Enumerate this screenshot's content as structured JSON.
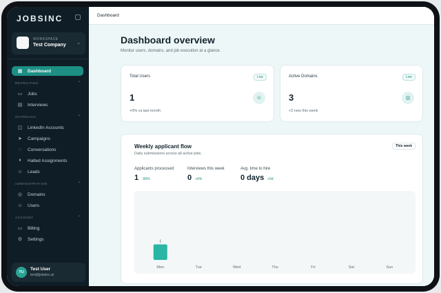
{
  "app": {
    "logo": "JOBSINC",
    "workspace_kicker": "WORKSPACE",
    "workspace_name": "Test Company"
  },
  "sidebar": {
    "dashboard": "Dashboard",
    "sections": {
      "recruiting": "RECRUITING",
      "outreach": "OUTREACH",
      "administration": "ADMINISTRATION",
      "account": "ACCOUNT"
    },
    "items": {
      "jobs": "Jobs",
      "interviews": "Interviews",
      "linkedin": "LinkedIn Accounts",
      "campaigns": "Campaigns",
      "conversations": "Conversations",
      "halted": "Halted Assignments",
      "leads": "Leads",
      "domains": "Domains",
      "users": "Users",
      "billing": "Billing",
      "settings": "Settings"
    },
    "user": {
      "initials": "TU",
      "name": "Test User",
      "email": "test@jobsinc.ai"
    }
  },
  "topbar": {
    "breadcrumb": "Dashboard"
  },
  "page": {
    "title": "Dashboard overview",
    "subtitle": "Monitor users, domains, and job execution at a glance."
  },
  "stats": {
    "users": {
      "label": "Total Users",
      "badge": "Live",
      "value": "1",
      "note": "+0% vs last month"
    },
    "domains": {
      "label": "Active Domains",
      "badge": "Live",
      "value": "3",
      "note": "+2 new this week"
    }
  },
  "weekly": {
    "title": "Weekly applicant flow",
    "subtitle": "Daily submissions across all active jobs.",
    "badge": "This week",
    "metrics": {
      "applicants": {
        "label": "Applicants processed",
        "value": "1",
        "delta": "-95%"
      },
      "interviews": {
        "label": "Interviews this week",
        "value": "0",
        "delta": "+0%"
      },
      "time_to_hire": {
        "label": "Avg. time to hire",
        "value": "0 days",
        "delta": "+0d"
      }
    }
  },
  "chart_data": {
    "type": "bar",
    "categories": [
      "Mon",
      "Tue",
      "Wed",
      "Thu",
      "Fri",
      "Sat",
      "Sun"
    ],
    "values": [
      1,
      0,
      0,
      0,
      0,
      0,
      0
    ],
    "data_labels": [
      "1",
      "",
      "",
      "",
      "",
      "",
      ""
    ],
    "ylim": [
      0,
      4
    ],
    "grid": false,
    "bar_color": "#2bb5a5"
  },
  "colors": {
    "accent": "#1d8f84",
    "sidebar_bg": "#0f1d26"
  }
}
